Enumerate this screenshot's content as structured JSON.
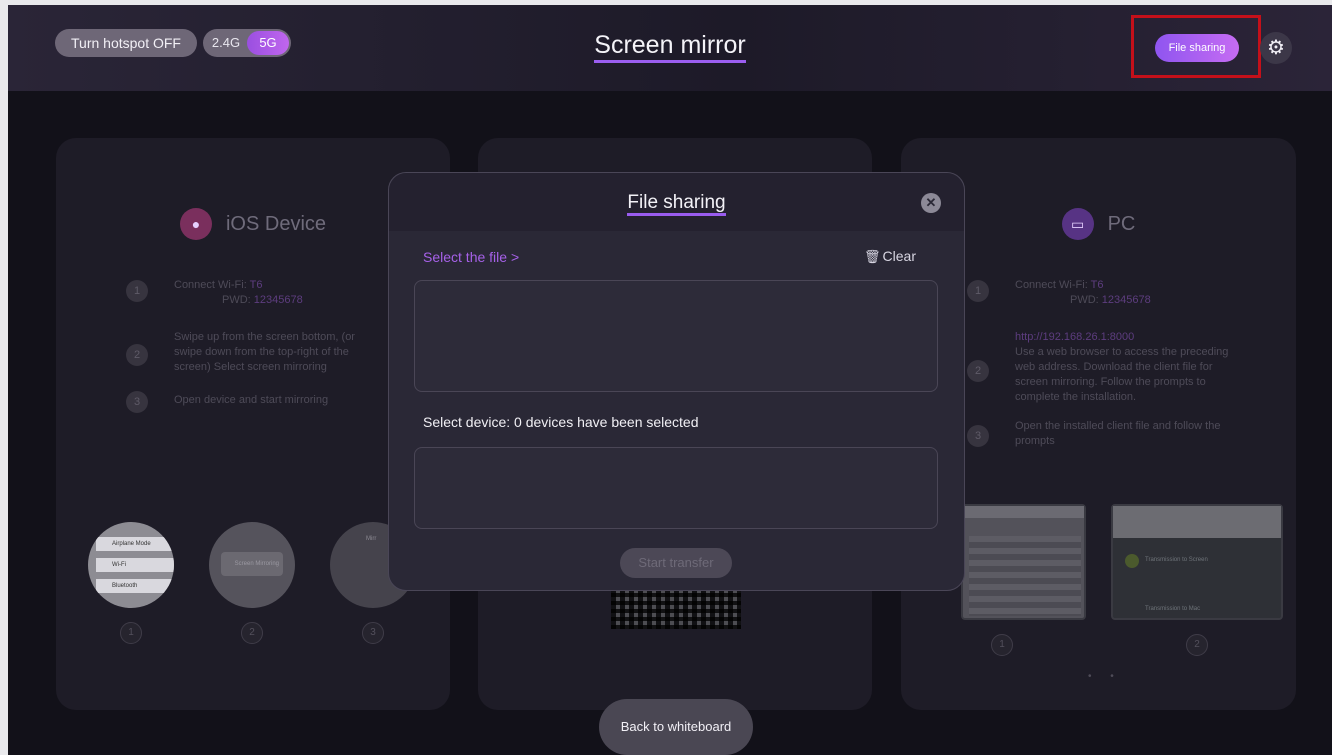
{
  "header": {
    "hotspot_button": "Turn hotspot OFF",
    "band_options": [
      "2.4G",
      "5G"
    ],
    "band_selected": "5G",
    "title": "Screen mirror",
    "file_sharing_button": "File sharing",
    "settings_icon": "gear-icon"
  },
  "cards": {
    "ios": {
      "title": "iOS Device",
      "icon": "apple-icon",
      "step1_connect": "Connect",
      "step1_wifi_label": "Wi-Fi:",
      "step1_wifi_value": "T6",
      "step1_pwd_label": "PWD:",
      "step1_pwd_value": "12345678",
      "step2_text": "Swipe up from the screen bottom, (or swipe down from the top-right of the screen) Select screen mirroring",
      "step3_text": "Open device and start mirroring",
      "step_numbers": [
        "1",
        "2",
        "3"
      ],
      "thumb1_rows": [
        "Airplane Mode",
        "Wi-Fi",
        "Bluetooth"
      ],
      "thumb2_text": "Screen Mirroring",
      "thumb3_text": "Mirr",
      "thumb_labels": [
        "1",
        "2",
        "3"
      ]
    },
    "pc": {
      "title": "PC",
      "icon": "monitor-icon",
      "step1_connect": "Connect",
      "step1_wifi_label": "Wi-Fi:",
      "step1_wifi_value": "T6",
      "step1_pwd_label": "PWD:",
      "step1_pwd_value": "12345678",
      "step2_link": "http://192.168.26.1:8000",
      "step2_text": "Use a web browser to access the preceding web address. Download the client file for screen mirroring. Follow the prompts to complete the installation.",
      "step3_text": "Open the installed client file and follow the prompts",
      "step_numbers": [
        "1",
        "2",
        "3"
      ],
      "shot_labels": [
        "1",
        "2"
      ],
      "shot2_line1": "Transmission to Screen",
      "shot2_line2": "Transmission to Mac"
    }
  },
  "modal": {
    "title": "File sharing",
    "close_icon": "close-icon",
    "select_file": "Select the file >",
    "clear_label": "Clear",
    "clear_icon": "trash-icon",
    "device_label": "Select device: 0 devices have been selected",
    "start_button": "Start transfer"
  },
  "footer": {
    "back_button": "Back to whiteboard"
  },
  "colors": {
    "accent": "#9b5ef0",
    "highlight_box": "#c4101a",
    "background": "#121119"
  }
}
